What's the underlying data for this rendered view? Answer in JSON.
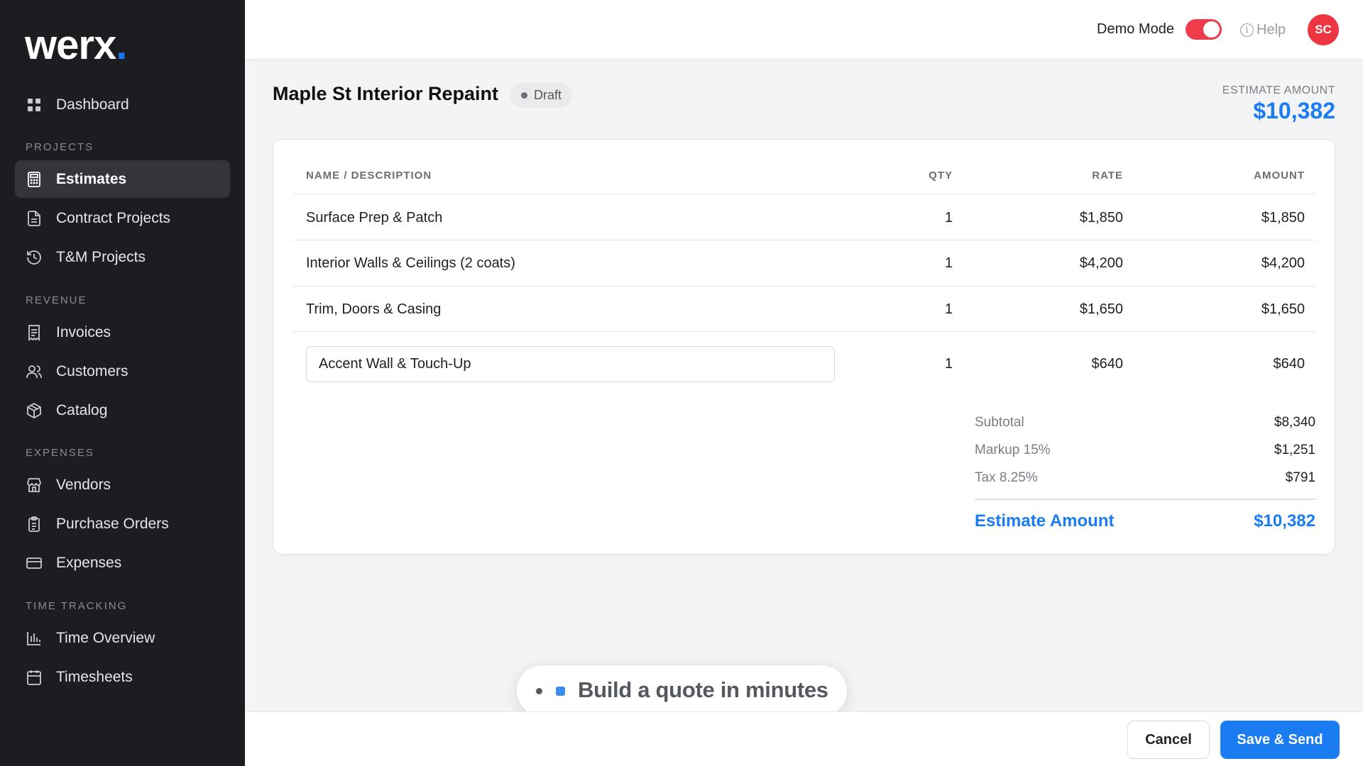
{
  "brand": {
    "name": "werx",
    "dot": "."
  },
  "sidebar": {
    "dashboard": {
      "label": "Dashboard",
      "icon": "grid-icon"
    },
    "sections": [
      {
        "label": "PROJECTS",
        "items": [
          {
            "label": "Estimates",
            "icon": "calculator-icon",
            "active": true
          },
          {
            "label": "Contract Projects",
            "icon": "document-icon"
          },
          {
            "label": "T&M Projects",
            "icon": "history-icon"
          }
        ]
      },
      {
        "label": "REVENUE",
        "items": [
          {
            "label": "Invoices",
            "icon": "receipt-icon"
          },
          {
            "label": "Customers",
            "icon": "users-icon"
          },
          {
            "label": "Catalog",
            "icon": "box-icon"
          }
        ]
      },
      {
        "label": "EXPENSES",
        "items": [
          {
            "label": "Vendors",
            "icon": "store-icon"
          },
          {
            "label": "Purchase Orders",
            "icon": "clipboard-icon"
          },
          {
            "label": "Expenses",
            "icon": "credit-card-icon"
          }
        ]
      },
      {
        "label": "TIME TRACKING",
        "items": [
          {
            "label": "Time Overview",
            "icon": "bar-chart-icon"
          },
          {
            "label": "Timesheets",
            "icon": "calendar-icon"
          }
        ]
      }
    ]
  },
  "topbar": {
    "demo_mode_label": "Demo Mode",
    "demo_mode_on": true,
    "help_label": "Help",
    "avatar_initials": "SC"
  },
  "header": {
    "title": "Maple St Interior Repaint",
    "status": "Draft",
    "estimate_label": "ESTIMATE AMOUNT",
    "estimate_value": "$10,382"
  },
  "table": {
    "headers": {
      "name": "NAME / DESCRIPTION",
      "qty": "QTY",
      "rate": "RATE",
      "amount": "AMOUNT"
    },
    "rows": [
      {
        "name": "Surface Prep & Patch",
        "qty": "1",
        "rate": "$1,850",
        "amount": "$1,850"
      },
      {
        "name": "Interior Walls & Ceilings (2 coats)",
        "qty": "1",
        "rate": "$4,200",
        "amount": "$4,200"
      },
      {
        "name": "Trim, Doors & Casing",
        "qty": "1",
        "rate": "$1,650",
        "amount": "$1,650"
      }
    ],
    "edit_row": {
      "name": "Accent Wall & Touch-Up",
      "qty": "1",
      "rate": "$640",
      "amount": "$640"
    }
  },
  "totals": {
    "subtotal_label": "Subtotal",
    "subtotal_value": "$8,340",
    "markup_label": "Markup 15%",
    "markup_value": "$1,251",
    "tax_label": "Tax 8.25%",
    "tax_value": "$791",
    "grand_label": "Estimate Amount",
    "grand_value": "$10,382"
  },
  "toast": {
    "text": "Build a quote in minutes"
  },
  "footer": {
    "cancel_label": "Cancel",
    "save_label": "Save & Send"
  },
  "colors": {
    "accent": "#1a7cf0",
    "sidebar_bg": "#1c1d21",
    "toggle_on": "#ef3b4a",
    "avatar": "#ee3542"
  }
}
